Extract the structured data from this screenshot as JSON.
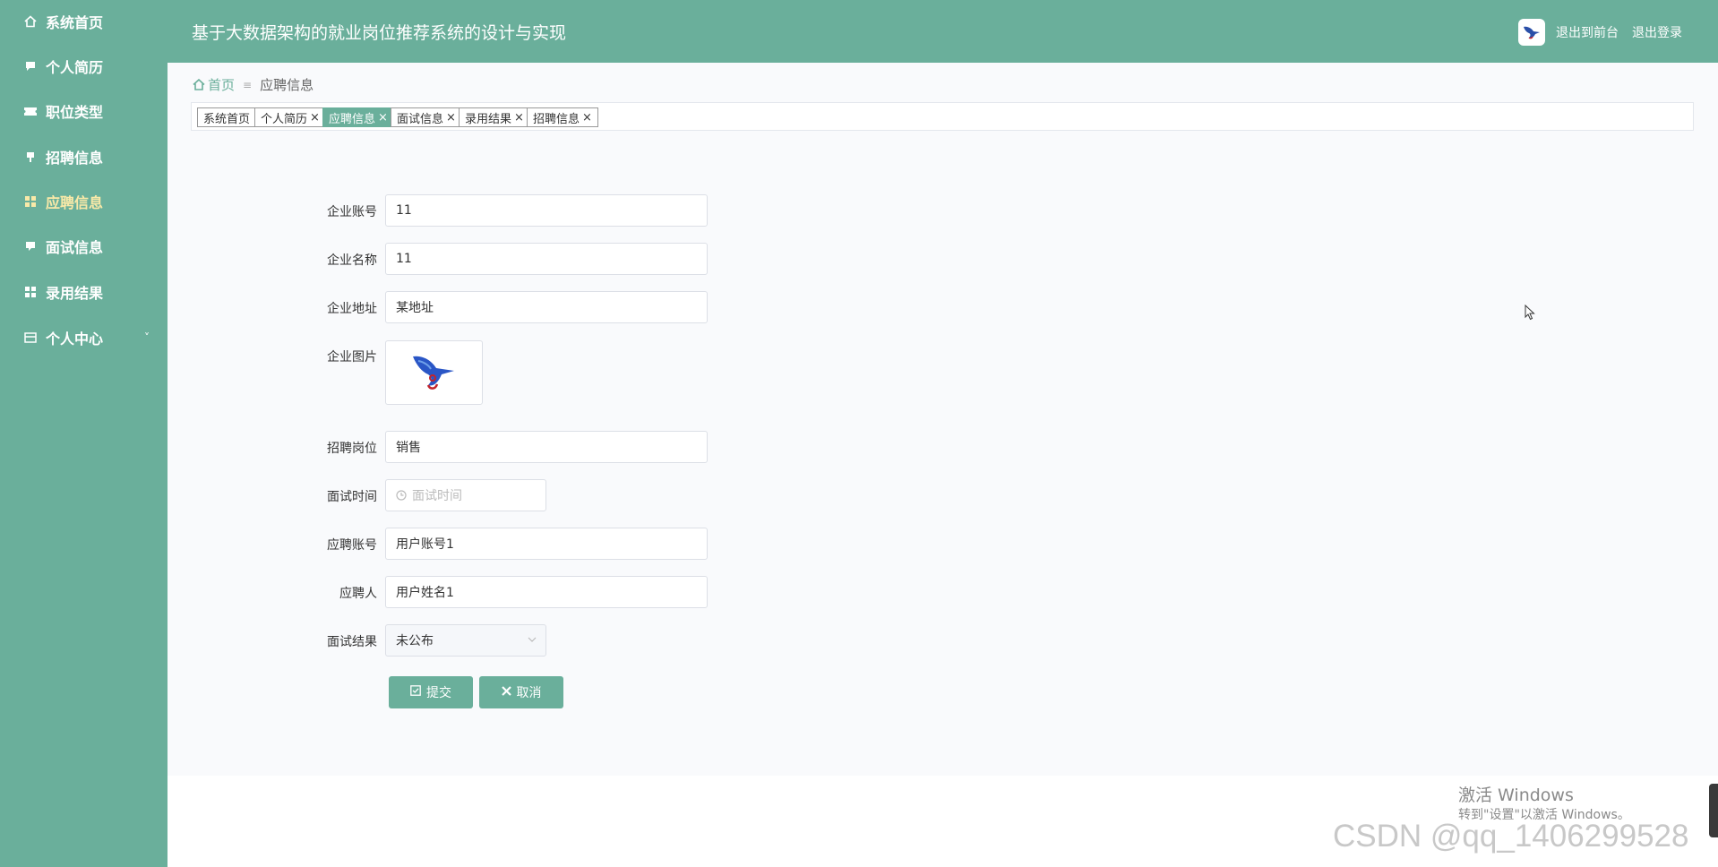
{
  "sidebar": {
    "items": [
      {
        "label": "系统首页",
        "icon": "home-icon"
      },
      {
        "label": "个人简历",
        "icon": "chat-icon"
      },
      {
        "label": "职位类型",
        "icon": "ticket-icon"
      },
      {
        "label": "招聘信息",
        "icon": "pin-icon"
      },
      {
        "label": "应聘信息",
        "icon": "grid-icon",
        "active": true
      },
      {
        "label": "面试信息",
        "icon": "comment-icon"
      },
      {
        "label": "录用结果",
        "icon": "grid-icon"
      },
      {
        "label": "个人中心",
        "icon": "card-icon",
        "chevron": "˅"
      }
    ]
  },
  "header": {
    "title": "基于大数据架构的就业岗位推荐系统的设计与实现",
    "front_link": "退出到前台",
    "logout_link": "退出登录"
  },
  "breadcrumb": {
    "home": "首页",
    "separator": "≡",
    "current": "应聘信息"
  },
  "tags": [
    {
      "label": "系统首页",
      "closable": false
    },
    {
      "label": "个人简历",
      "closable": true
    },
    {
      "label": "应聘信息",
      "closable": true,
      "active": true
    },
    {
      "label": "面试信息",
      "closable": true
    },
    {
      "label": "录用结果",
      "closable": true
    },
    {
      "label": "招聘信息",
      "closable": true
    }
  ],
  "tag_close": "×",
  "form": {
    "company_account": {
      "label": "企业账号",
      "value": "11"
    },
    "company_name": {
      "label": "企业名称",
      "value": "11"
    },
    "company_address": {
      "label": "企业地址",
      "value": "某地址"
    },
    "company_image": {
      "label": "企业图片"
    },
    "job_position": {
      "label": "招聘岗位",
      "value": "销售"
    },
    "interview_time": {
      "label": "面试时间",
      "placeholder": "面试时间"
    },
    "applicant_account": {
      "label": "应聘账号",
      "value": "用户账号1"
    },
    "applicant": {
      "label": "应聘人",
      "value": "用户姓名1"
    },
    "interview_result": {
      "label": "面试结果",
      "value": "未公布"
    }
  },
  "buttons": {
    "submit": "提交",
    "cancel": "取消"
  },
  "watermark": {
    "activate_title": "激活 Windows",
    "activate_sub": "转到\"设置\"以激活 Windows。",
    "csdn": "CSDN @qq_1406299528"
  },
  "colors": {
    "theme": "#6aaf9b",
    "active_menu_text": "#f9e9a8"
  }
}
